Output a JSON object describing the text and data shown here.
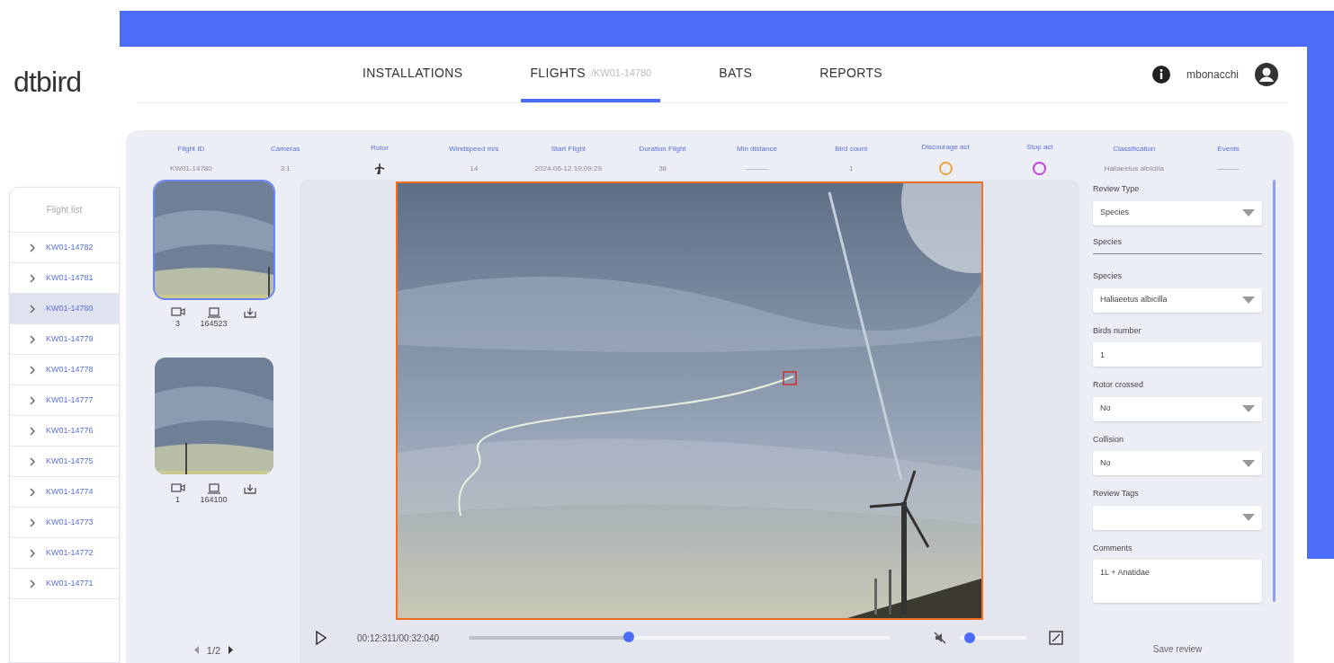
{
  "logo": "dtbird",
  "nav": [
    {
      "label": "INSTALLATIONS",
      "selected": false
    },
    {
      "label": "FLIGHTS",
      "sub": "/KW01-14780",
      "selected": true
    },
    {
      "label": "BATS",
      "selected": false
    },
    {
      "label": "REPORTS",
      "selected": false
    }
  ],
  "user": {
    "name": "mbonacchi"
  },
  "flight_list": {
    "header": "Flight list",
    "items": [
      {
        "label": "KW01-14782",
        "selected": false
      },
      {
        "label": "KW01-14781",
        "selected": false
      },
      {
        "label": "KW01-14780",
        "selected": true
      },
      {
        "label": "KW01-14779",
        "selected": false
      },
      {
        "label": "KW01-14778",
        "selected": false
      },
      {
        "label": "KW01-14777",
        "selected": false
      },
      {
        "label": "KW01-14776",
        "selected": false
      },
      {
        "label": "KW01-14775",
        "selected": false
      },
      {
        "label": "KW01-14774",
        "selected": false
      },
      {
        "label": "KW01-14773",
        "selected": false
      },
      {
        "label": "KW01-14772",
        "selected": false
      },
      {
        "label": "KW01-14771",
        "selected": false
      }
    ]
  },
  "summary": [
    {
      "label": "Flight ID",
      "kind": "text",
      "value": "KW01-14780"
    },
    {
      "label": "Cameras",
      "kind": "text",
      "value": "3 1"
    },
    {
      "label": "Rotor",
      "kind": "rotor"
    },
    {
      "label": "Windspeed m/s",
      "kind": "text",
      "value": "14"
    },
    {
      "label": "Start Flight",
      "kind": "text",
      "value": "2024-06-12 10:09:29"
    },
    {
      "label": "Duration Flight",
      "kind": "text",
      "value": "38"
    },
    {
      "label": "Min distance",
      "kind": "text",
      "value": "———"
    },
    {
      "label": "Bird count",
      "kind": "text",
      "value": "1"
    },
    {
      "label": "Discourage act",
      "kind": "ring",
      "color": "#f0a040"
    },
    {
      "label": "Stop act",
      "kind": "ring",
      "color": "#c040e0"
    },
    {
      "label": "Classification",
      "kind": "text",
      "value": "Haliaeetus albicilla"
    },
    {
      "label": "Events",
      "kind": "text",
      "value": "———"
    }
  ],
  "thumbnails": [
    {
      "camera": "3",
      "frame": "164523",
      "selected": true
    },
    {
      "camera": "1",
      "frame": "164100",
      "selected": false
    }
  ],
  "pager": "1/2",
  "player": {
    "time": "00:12:311/00:32:040",
    "progress": {
      "level": 0.38
    },
    "volume": {
      "level": 0.15
    }
  },
  "review": {
    "fields": [
      {
        "kind": "select",
        "label": "Review Type",
        "value": "Species"
      },
      {
        "kind": "section",
        "label": "Species"
      },
      {
        "kind": "select",
        "label": "Species",
        "value": "Haliaeetus albicilla"
      },
      {
        "kind": "input",
        "label": "Birds number",
        "value": "1"
      },
      {
        "kind": "select",
        "label": "Rotor crossed",
        "value": "No"
      },
      {
        "kind": "select",
        "label": "Collision",
        "value": "No"
      },
      {
        "kind": "select",
        "label": "Review Tags"
      },
      {
        "kind": "textarea",
        "label": "Comments",
        "value": "1L + Anatidae"
      }
    ],
    "save": "Save review"
  }
}
